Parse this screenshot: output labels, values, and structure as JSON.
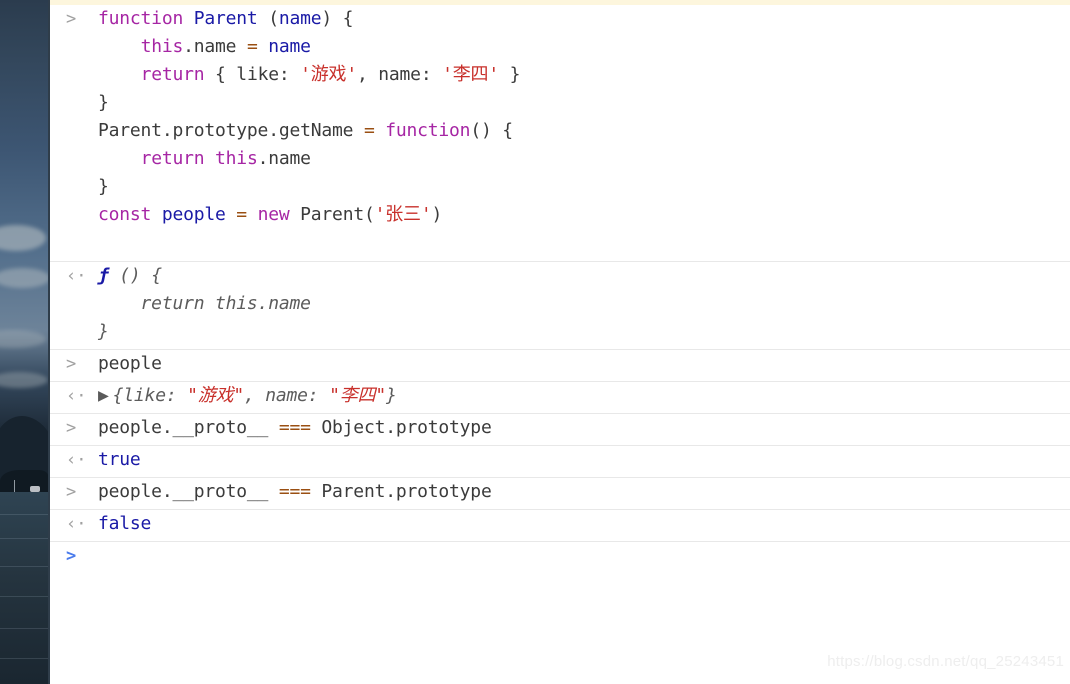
{
  "window": {
    "title": "Chrome DevTools Console",
    "watermark": "https://blog.csdn.net/qq_25243451"
  },
  "markers": {
    "input_prompt": ">",
    "output_prompt": "‹·",
    "disclosure_triangle": "▶"
  },
  "colors": {
    "keyword": "#a626a4",
    "identifier": "#1a1aa6",
    "string": "#c8302b",
    "operator": "#9a4f12",
    "plain": "#3b3b3b",
    "boolean": "#1a1aa6",
    "separator": "#e8e8e8",
    "topbar": "#fdf6dd",
    "prompt_blue": "#4a7bec"
  },
  "entries": [
    {
      "id": "entry-1",
      "type": "input",
      "lines": [
        {
          "tokens": [
            {
              "t": "function ",
              "c": "kw"
            },
            {
              "t": "Parent ",
              "c": "cls"
            },
            {
              "t": "(",
              "c": "plain"
            },
            {
              "t": "name",
              "c": "var"
            },
            {
              "t": ") {",
              "c": "plain"
            }
          ]
        },
        {
          "tokens": [
            {
              "t": "    ",
              "c": "plain"
            },
            {
              "t": "this",
              "c": "kw"
            },
            {
              "t": ".name ",
              "c": "plain"
            },
            {
              "t": "= ",
              "c": "op"
            },
            {
              "t": "name",
              "c": "var"
            }
          ]
        },
        {
          "tokens": [
            {
              "t": "    ",
              "c": "plain"
            },
            {
              "t": "return",
              "c": "kw"
            },
            {
              "t": " { like: ",
              "c": "plain"
            },
            {
              "t": "'游戏'",
              "c": "str"
            },
            {
              "t": ", name: ",
              "c": "plain"
            },
            {
              "t": "'李四'",
              "c": "str"
            },
            {
              "t": " }",
              "c": "plain"
            }
          ]
        },
        {
          "tokens": [
            {
              "t": "}",
              "c": "plain"
            }
          ]
        },
        {
          "tokens": [
            {
              "t": "Parent.prototype.getName ",
              "c": "plain"
            },
            {
              "t": "= ",
              "c": "op"
            },
            {
              "t": "function",
              "c": "kw"
            },
            {
              "t": "() {",
              "c": "plain"
            }
          ]
        },
        {
          "tokens": [
            {
              "t": "    ",
              "c": "plain"
            },
            {
              "t": "return ",
              "c": "kw"
            },
            {
              "t": "this",
              "c": "kw"
            },
            {
              "t": ".name",
              "c": "plain"
            }
          ]
        },
        {
          "tokens": [
            {
              "t": "}",
              "c": "plain"
            }
          ]
        },
        {
          "tokens": [
            {
              "t": "",
              "c": "plain"
            }
          ]
        },
        {
          "tokens": [
            {
              "t": "const ",
              "c": "kw"
            },
            {
              "t": "people ",
              "c": "var"
            },
            {
              "t": "= ",
              "c": "op"
            },
            {
              "t": "new ",
              "c": "kw"
            },
            {
              "t": "Parent(",
              "c": "plain"
            },
            {
              "t": "'张三'",
              "c": "str"
            },
            {
              "t": ")",
              "c": "plain"
            }
          ]
        }
      ]
    },
    {
      "id": "entry-1-result",
      "type": "output",
      "italic": true,
      "lines": [
        {
          "tokens": [
            {
              "t": "ƒ",
              "c": "fn"
            },
            {
              "t": " () {",
              "c": "gray"
            }
          ]
        },
        {
          "tokens": [
            {
              "t": "    return this.name",
              "c": "gray"
            }
          ]
        },
        {
          "tokens": [
            {
              "t": "}",
              "c": "gray"
            }
          ]
        }
      ]
    },
    {
      "id": "entry-2",
      "type": "input",
      "lines": [
        {
          "tokens": [
            {
              "t": "people",
              "c": "plain"
            }
          ]
        }
      ]
    },
    {
      "id": "entry-2-result",
      "type": "output",
      "italic": true,
      "expandable": true,
      "lines": [
        {
          "tokens": [
            {
              "t": "{like: ",
              "c": "gray"
            },
            {
              "t": "\"游戏\"",
              "c": "str"
            },
            {
              "t": ", name: ",
              "c": "gray"
            },
            {
              "t": "\"李四\"",
              "c": "str"
            },
            {
              "t": "}",
              "c": "gray"
            }
          ]
        }
      ]
    },
    {
      "id": "entry-3",
      "type": "input",
      "lines": [
        {
          "tokens": [
            {
              "t": "people.__proto__ ",
              "c": "plain"
            },
            {
              "t": "=== ",
              "c": "op"
            },
            {
              "t": "Object.prototype",
              "c": "plain"
            }
          ]
        }
      ]
    },
    {
      "id": "entry-3-result",
      "type": "output",
      "lines": [
        {
          "tokens": [
            {
              "t": "true",
              "c": "bool"
            }
          ]
        }
      ]
    },
    {
      "id": "entry-4",
      "type": "input",
      "lines": [
        {
          "tokens": [
            {
              "t": "people.__proto__ ",
              "c": "plain"
            },
            {
              "t": "=== ",
              "c": "op"
            },
            {
              "t": "Parent.prototype",
              "c": "plain"
            }
          ]
        }
      ]
    },
    {
      "id": "entry-4-result",
      "type": "output",
      "lines": [
        {
          "tokens": [
            {
              "t": "false",
              "c": "bool"
            }
          ]
        }
      ]
    },
    {
      "id": "entry-5",
      "type": "prompt",
      "lines": [
        {
          "tokens": [
            {
              "t": "",
              "c": "plain"
            }
          ]
        }
      ]
    }
  ]
}
